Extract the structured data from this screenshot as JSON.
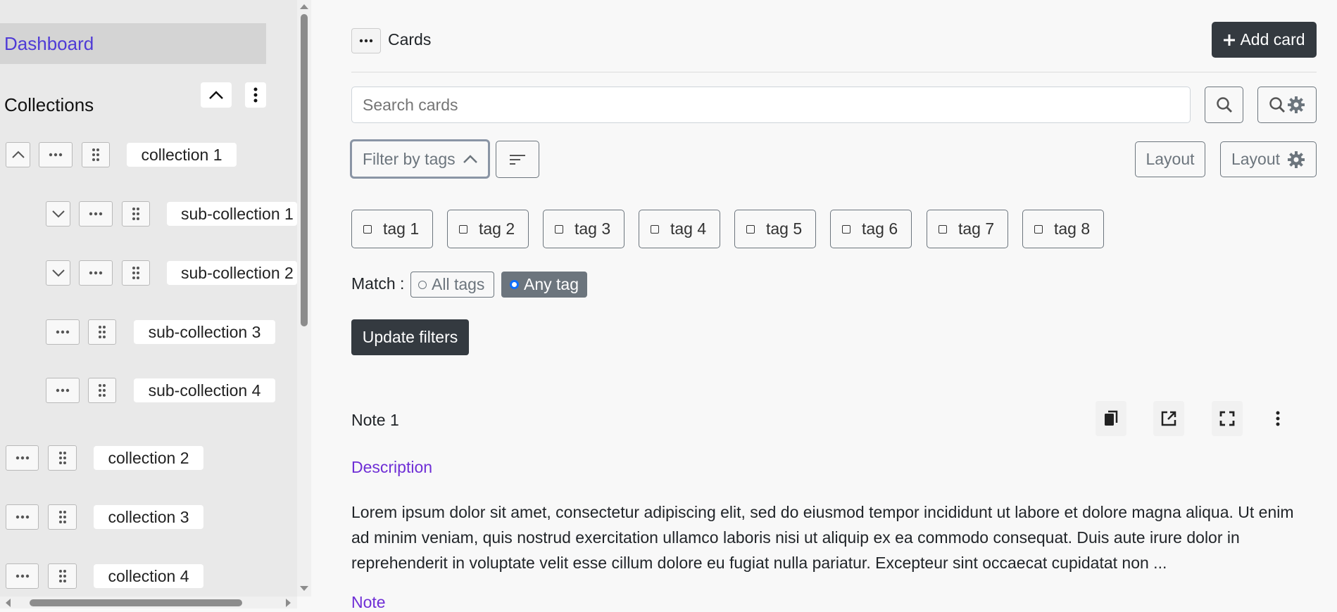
{
  "sidebar": {
    "dashboard_label": "Dashboard",
    "collections_heading": "Collections",
    "collections": [
      {
        "label": "collection 1"
      },
      {
        "label": "sub-collection 1"
      },
      {
        "label": "sub-collection 2"
      },
      {
        "label": "sub-collection 3"
      },
      {
        "label": "sub-collection 4"
      },
      {
        "label": "collection 2"
      },
      {
        "label": "collection 3"
      },
      {
        "label": "collection 4"
      }
    ]
  },
  "header": {
    "title": "Cards",
    "add_card_label": "Add card"
  },
  "search": {
    "placeholder": "Search cards"
  },
  "filters": {
    "filter_by_tags_label": "Filter by tags",
    "layout_label": "Layout",
    "layout_settings_label": "Layout",
    "tags": [
      "tag 1",
      "tag 2",
      "tag 3",
      "tag 4",
      "tag 5",
      "tag 6",
      "tag 7",
      "tag 8"
    ],
    "match_label": "Match :",
    "match_options": [
      "All tags",
      "Any tag"
    ],
    "selected_match": "Any tag",
    "update_label": "Update filters"
  },
  "card": {
    "title": "Note 1",
    "description_heading": "Description",
    "description_text": "Lorem ipsum dolor sit amet, consectetur adipiscing elit, sed do eiusmod tempor incididunt ut labore et dolore magna aliqua. Ut enim ad minim veniam, quis nostrud exercitation ullamco laboris nisi ut aliquip ex ea commodo consequat. Duis aute irure dolor in reprehenderit in voluptate velit esse cillum dolore eu fugiat nulla pariatur. Excepteur sint occaecat cupidatat non ...",
    "note_heading": "Note"
  },
  "colors": {
    "accent": "#4f3bd6",
    "heading_purple": "#6f2fd6",
    "dark_button": "#343a40",
    "selected_option": "#6c757d"
  }
}
